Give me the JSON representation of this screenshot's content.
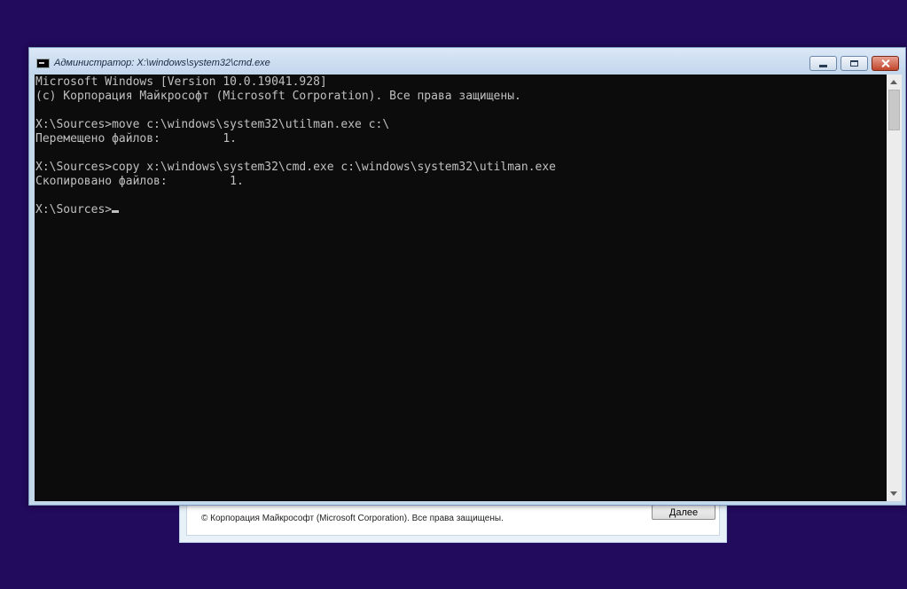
{
  "background_window": {
    "copyright": "© Корпорация Майкрософт (Microsoft Corporation). Все права защищены.",
    "next_button": "Далее"
  },
  "cmd_window": {
    "title": "Администратор: X:\\windows\\system32\\cmd.exe",
    "icon": "console-app-icon",
    "lines": [
      "Microsoft Windows [Version 10.0.19041.928]",
      "(c) Корпорация Майкрософт (Microsoft Corporation). Все права защищены.",
      "",
      "X:\\Sources>move c:\\windows\\system32\\utilman.exe c:\\",
      "Перемещено файлов:         1.",
      "",
      "X:\\Sources>copy x:\\windows\\system32\\cmd.exe c:\\windows\\system32\\utilman.exe",
      "Скопировано файлов:         1.",
      ""
    ],
    "prompt": "X:\\Sources>"
  },
  "colors": {
    "desktop": "#220a5c",
    "console_bg": "#0c0c0c",
    "console_fg": "#c0c0c0"
  }
}
